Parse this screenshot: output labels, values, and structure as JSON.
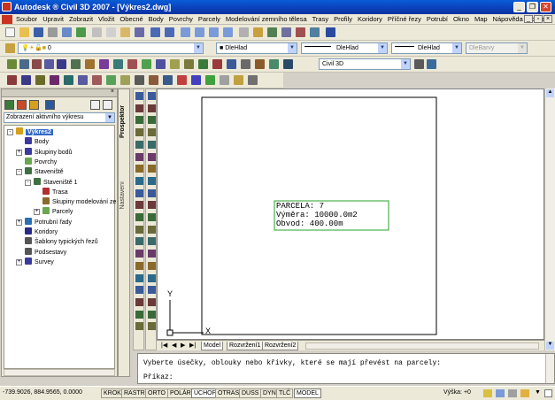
{
  "window": {
    "title": "Autodesk ® Civil 3D 2007 - [Výkres2.dwg]",
    "controls": [
      "_",
      "❐",
      "✕"
    ]
  },
  "menubar": [
    "Soubor",
    "Upravit",
    "Zobrazit",
    "Vložit",
    "Obecné",
    "Body",
    "Povrchy",
    "Parcely",
    "Modelování zemního tělesa",
    "Trasy",
    "Profily",
    "Koridory",
    "Příčné řezy",
    "Potrubí",
    "Okno",
    "Map",
    "Nápověda",
    "Express"
  ],
  "toolbar": {
    "layer_combo": "0",
    "color_combo": "DleHlad",
    "linetype_combo": "DleHlad",
    "lineweight_combo": "DleHlad",
    "plotstyle_combo": "DleBarvy",
    "workspace_combo": "Civil 3D"
  },
  "palette": {
    "view_dropdown": "Zobrazení aktivního výkresu",
    "tab_prospector": "Prospektor",
    "tab_settings": "Nastavení",
    "tree": [
      {
        "label": "Výkres2",
        "depth": 0,
        "toggle": "-",
        "selected": true,
        "color": "#d4a017"
      },
      {
        "label": "Body",
        "depth": 1,
        "toggle": "",
        "color": "#3a3aa0"
      },
      {
        "label": "Skupiny bodů",
        "depth": 1,
        "toggle": "+",
        "color": "#3a3aa0"
      },
      {
        "label": "Povrchy",
        "depth": 1,
        "toggle": "",
        "color": "#6aa84f"
      },
      {
        "label": "Staveniště",
        "depth": 1,
        "toggle": "-",
        "color": "#3f6f3f"
      },
      {
        "label": "Staveniště 1",
        "depth": 2,
        "toggle": "-",
        "color": "#3f6f3f"
      },
      {
        "label": "Trasa",
        "depth": 3,
        "toggle": "",
        "color": "#b03030"
      },
      {
        "label": "Skupiny modelování ze",
        "depth": 3,
        "toggle": "",
        "color": "#8a6a2a"
      },
      {
        "label": "Parcely",
        "depth": 3,
        "toggle": "+",
        "color": "#6aa84f"
      },
      {
        "label": "Potrubní řady",
        "depth": 1,
        "toggle": "+",
        "color": "#2a6fb0"
      },
      {
        "label": "Koridory",
        "depth": 1,
        "toggle": "",
        "color": "#2a2a8a"
      },
      {
        "label": "Šablony typických řezů",
        "depth": 1,
        "toggle": "",
        "color": "#555555"
      },
      {
        "label": "Podsestavy",
        "depth": 1,
        "toggle": "",
        "color": "#555555"
      },
      {
        "label": "Survey",
        "depth": 1,
        "toggle": "+",
        "color": "#3a3aa0"
      }
    ]
  },
  "drawing": {
    "parcel_name": "PARCELA: 7",
    "parcel_area": "Výměra: 10000.0m2",
    "parcel_perimeter": "Obvod: 400.00m",
    "ucs_x": "X",
    "ucs_y": "Y",
    "layout_tabs": [
      "Model",
      "Rozvržení1",
      "Rozvržení2"
    ]
  },
  "command": {
    "history": "Vyberte úsečky, oblouky nebo křivky, které se mají převést na parcely:",
    "prompt": "Příkaz:"
  },
  "status": {
    "coords": "-739.9026, 884.9565, 0.0000",
    "toggles": [
      {
        "label": "KROK",
        "on": false
      },
      {
        "label": "RASTR",
        "on": false
      },
      {
        "label": "ORTO",
        "on": false
      },
      {
        "label": "POLÁR",
        "on": false
      },
      {
        "label": "UCHOP",
        "on": true
      },
      {
        "label": "OTRAS",
        "on": false
      },
      {
        "label": "DUSS",
        "on": false
      },
      {
        "label": "DYN",
        "on": false
      },
      {
        "label": "TLČ",
        "on": false
      },
      {
        "label": "MODEL",
        "on": true
      }
    ],
    "elevation": "Výška: +0"
  }
}
